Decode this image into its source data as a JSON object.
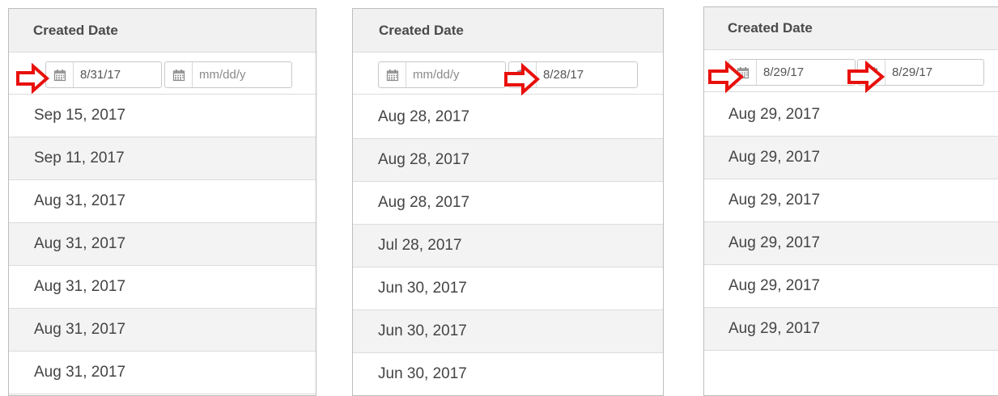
{
  "panels": [
    {
      "header": "Created Date",
      "filter": {
        "from": {
          "value": "8/31/17",
          "placeholder": "mm/dd/y"
        },
        "to": {
          "value": "",
          "placeholder": "mm/dd/y"
        }
      },
      "rows": [
        "Sep 15, 2017",
        "Sep 11, 2017",
        "Aug 31, 2017",
        "Aug 31, 2017",
        "Aug 31, 2017",
        "Aug 31, 2017",
        "Aug 31, 2017"
      ]
    },
    {
      "header": "Created Date",
      "filter": {
        "from": {
          "value": "",
          "placeholder": "mm/dd/y"
        },
        "to": {
          "value": "8/28/17",
          "placeholder": "mm/dd/y"
        }
      },
      "rows": [
        "Aug 28, 2017",
        "Aug 28, 2017",
        "Aug 28, 2017",
        "Jul 28, 2017",
        "Jun 30, 2017",
        "Jun 30, 2017",
        "Jun 30, 2017"
      ]
    },
    {
      "header": "Created Date",
      "filter": {
        "from": {
          "value": "8/29/17",
          "placeholder": "mm/dd/y"
        },
        "to": {
          "value": "8/29/17",
          "placeholder": "mm/dd/y"
        }
      },
      "rows": [
        "Aug 29, 2017",
        "Aug 29, 2017",
        "Aug 29, 2017",
        "Aug 29, 2017",
        "Aug 29, 2017",
        "Aug 29, 2017"
      ]
    }
  ],
  "icons": {
    "calendar": "calendar-icon",
    "annotation": "red-arrow-icon"
  },
  "colors": {
    "annotation": "#e8100c",
    "header_bg": "#f1f1f1",
    "zebra": "#f3f3f3"
  }
}
